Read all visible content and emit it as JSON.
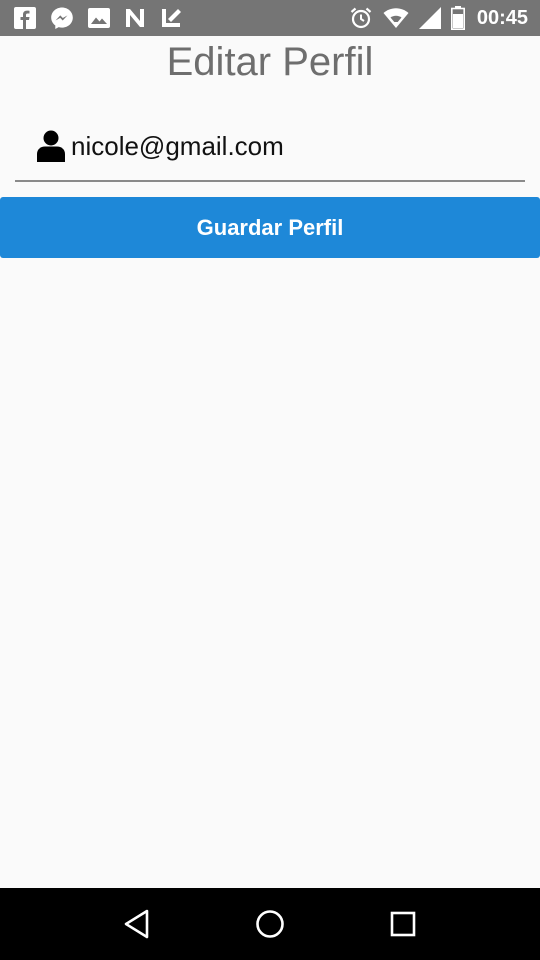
{
  "status_bar": {
    "left_icons": [
      "facebook-icon",
      "messenger-icon",
      "gallery-icon",
      "n-app-icon",
      "feedly-icon"
    ],
    "right_icons": [
      "alarm-icon",
      "wifi-icon",
      "signal-icon",
      "battery-icon"
    ],
    "time": "00:45"
  },
  "page": {
    "title": "Editar Perfil"
  },
  "form": {
    "email_icon": "user-icon",
    "email_value": "nicole@gmail.com",
    "save_label": "Guardar Perfil"
  },
  "colors": {
    "status_bar_bg": "#757575",
    "background": "#fafafa",
    "button_bg": "#1e88d8",
    "nav_bar_bg": "#000000"
  },
  "nav_bar": {
    "buttons": [
      "back-icon",
      "home-icon",
      "recents-icon"
    ]
  }
}
